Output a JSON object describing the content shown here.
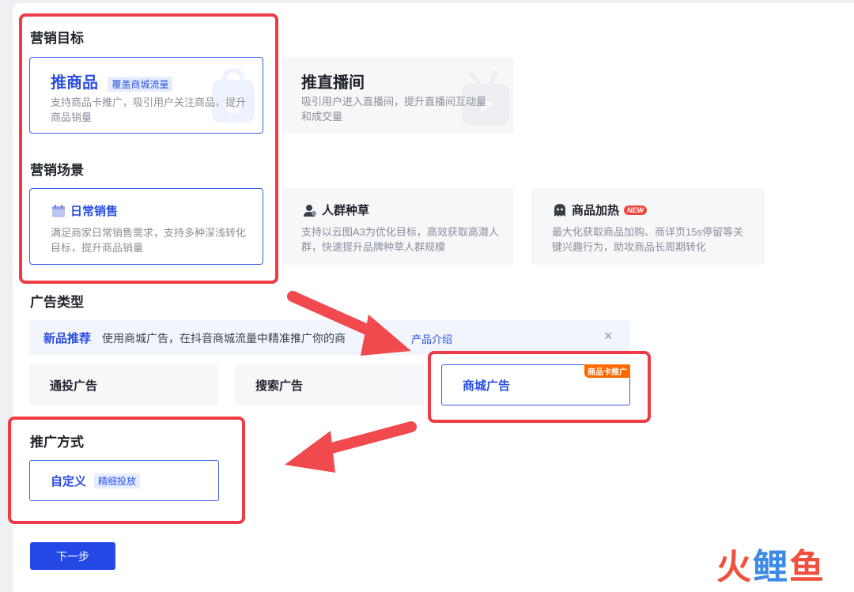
{
  "colors": {
    "accent": "#2b4ee0",
    "highlight_red": "#ee3b46",
    "arrow_red": "#f04a4f",
    "hot_tag": "#ff6a00"
  },
  "marketing_goal": {
    "title": "营销目标",
    "options": [
      {
        "title": "推商品",
        "tag": "覆盖商城流量",
        "desc": "支持商品卡推广，吸引用户关注商品，提升商品销量",
        "selected": true,
        "icon": "shopping-bag-watermark-icon"
      },
      {
        "title": "推直播间",
        "desc": "吸引用户进入直播间，提升直播间互动量和成交量",
        "selected": false,
        "icon": "tv-watermark-icon"
      }
    ]
  },
  "marketing_scene": {
    "title": "营销场景",
    "options": [
      {
        "title": "日常销售",
        "desc": "满足商家日常销售需求，支持多种深浅转化目标，提升商品销量",
        "selected": true,
        "icon": "calendar-icon"
      },
      {
        "title": "人群种草",
        "desc": "支持以云图A3为优化目标，高效获取高潜人群，快速提升品牌种草人群规模",
        "selected": false,
        "icon": "user-icon"
      },
      {
        "title": "商品加热",
        "badge": "NEW",
        "desc": "最大化获取商品加购、商详页15s停留等关键兴趣行为，助攻商品长周期转化",
        "selected": false,
        "icon": "ghost-icon"
      }
    ]
  },
  "ad_type": {
    "title": "广告类型",
    "notice": {
      "label": "新品推荐",
      "text": "使用商城广告，在抖音商城流量中精准推广你的商",
      "link": "产品介绍",
      "close": "×"
    },
    "options": [
      {
        "label": "通投广告",
        "selected": false
      },
      {
        "label": "搜索广告",
        "selected": false
      },
      {
        "label": "商城广告",
        "corner_tag": "商品卡推广",
        "selected": true
      }
    ]
  },
  "promo_method": {
    "title": "推广方式",
    "option": {
      "label": "自定义",
      "tag": "精细投放",
      "selected": true
    }
  },
  "next_button": "下一步",
  "watermark": {
    "text": "火鲤鱼"
  }
}
